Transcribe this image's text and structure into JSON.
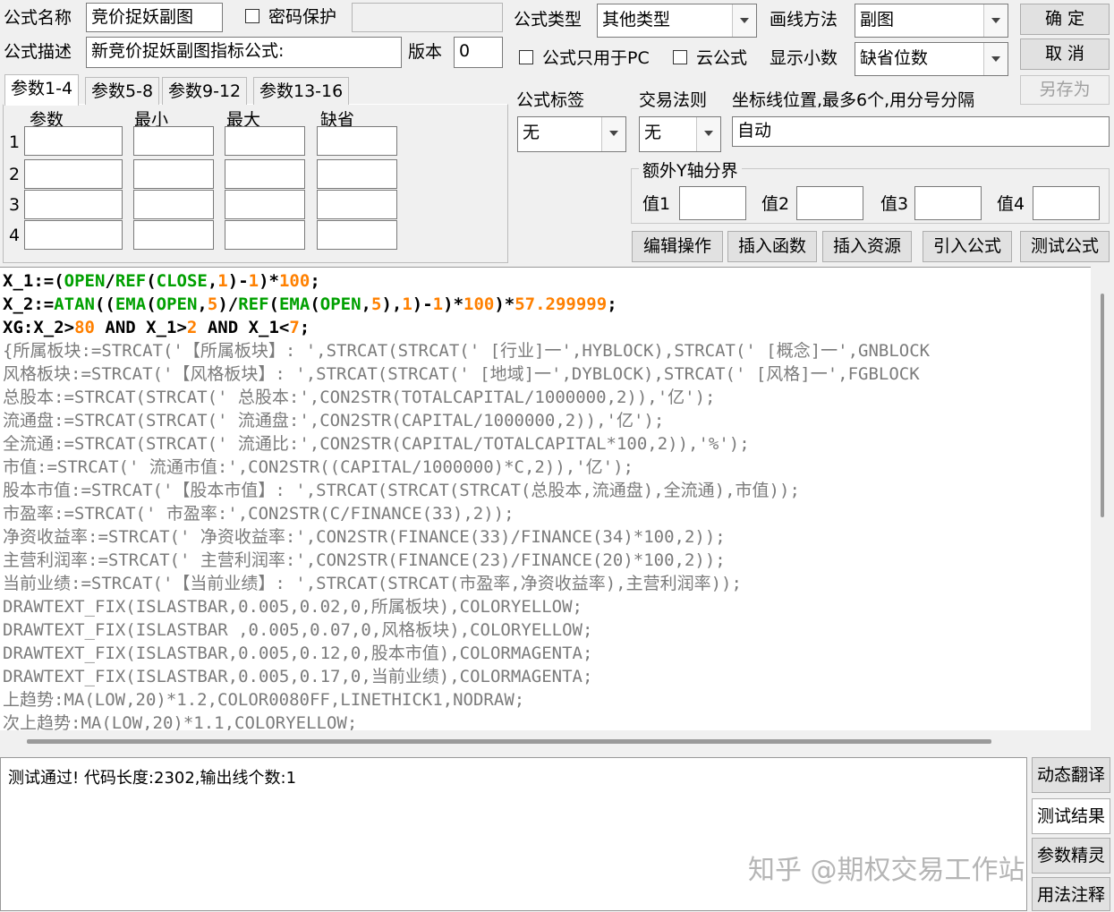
{
  "formula": {
    "name_label": "公式名称",
    "name_value": "竞价捉妖副图",
    "password_label": "密码保护",
    "password_value": "",
    "desc_label": "公式描述",
    "desc_value": "新竞价捉妖副图指标公式:",
    "version_label": "版本",
    "version_value": "0",
    "type_label": "公式类型",
    "type_value": "其他类型",
    "draw_label": "画线方法",
    "draw_value": "副图",
    "pc_only_label": "公式只用于PC",
    "cloud_label": "云公式",
    "decimals_label": "显示小数",
    "decimals_value": "缺省位数",
    "tag_label": "公式标签",
    "tag_value": "无",
    "rule_label": "交易法则",
    "rule_value": "无",
    "axis_label": "坐标线位置,最多6个,用分号分隔",
    "axis_value": "自动"
  },
  "buttons": {
    "ok": "确  定",
    "cancel": "取  消",
    "save_as": "另存为",
    "edit_ops": "编辑操作",
    "insert_func": "插入函数",
    "insert_res": "插入资源",
    "import_formula": "引入公式",
    "test_formula": "测试公式"
  },
  "yaxis": {
    "group_label": "额外Y轴分界",
    "v1_label": "值1",
    "v2_label": "值2",
    "v3_label": "值3",
    "v4_label": "值4"
  },
  "param_tabs": [
    "参数1-4",
    "参数5-8",
    "参数9-12",
    "参数13-16"
  ],
  "param_headers": [
    "参数",
    "最小",
    "最大",
    "缺省"
  ],
  "param_rows": [
    "1",
    "2",
    "3",
    "4"
  ],
  "code_lines": [
    [
      [
        "k",
        "X_1:=("
      ],
      [
        "g",
        "OPEN"
      ],
      [
        "k",
        "/"
      ],
      [
        "g",
        "REF"
      ],
      [
        "k",
        "("
      ],
      [
        "g",
        "CLOSE"
      ],
      [
        "k",
        ","
      ],
      [
        "o",
        "1"
      ],
      [
        "k",
        ")-"
      ],
      [
        "o",
        "1"
      ],
      [
        "k",
        ")*"
      ],
      [
        "o",
        "100"
      ],
      [
        "k",
        ";"
      ]
    ],
    [
      [
        "k",
        "X_2:="
      ],
      [
        "g",
        "ATAN"
      ],
      [
        "k",
        "(("
      ],
      [
        "g",
        "EMA"
      ],
      [
        "k",
        "("
      ],
      [
        "g",
        "OPEN"
      ],
      [
        "k",
        ","
      ],
      [
        "o",
        "5"
      ],
      [
        "k",
        ")/"
      ],
      [
        "g",
        "REF"
      ],
      [
        "k",
        "("
      ],
      [
        "g",
        "EMA"
      ],
      [
        "k",
        "("
      ],
      [
        "g",
        "OPEN"
      ],
      [
        "k",
        ","
      ],
      [
        "o",
        "5"
      ],
      [
        "k",
        "),"
      ],
      [
        "o",
        "1"
      ],
      [
        "k",
        ")-"
      ],
      [
        "o",
        "1"
      ],
      [
        "k",
        ")*"
      ],
      [
        "o",
        "100"
      ],
      [
        "k",
        ")*"
      ],
      [
        "o",
        "57.299999"
      ],
      [
        "k",
        ";"
      ]
    ],
    [
      [
        "k",
        "XG:X_2>"
      ],
      [
        "o",
        "80"
      ],
      [
        "k",
        " AND X_1>"
      ],
      [
        "o",
        "2"
      ],
      [
        "k",
        " AND X_1<"
      ],
      [
        "o",
        "7"
      ],
      [
        "k",
        ";"
      ]
    ],
    [
      [
        "gr",
        "{所属板块:=STRCAT('【所属板块】: ',STRCAT(STRCAT(' [行业]一',HYBLOCK),STRCAT(' [概念]一',GNBLOCK"
      ]
    ],
    [
      [
        "gr",
        "风格板块:=STRCAT('【风格板块】: ',STRCAT(STRCAT(' [地域]一',DYBLOCK),STRCAT(' [风格]一',FGBLOCK"
      ]
    ],
    [
      [
        "gr",
        "总股本:=STRCAT(STRCAT(' 总股本:',CON2STR(TOTALCAPITAL/1000000,2)),'亿');"
      ]
    ],
    [
      [
        "gr",
        "流通盘:=STRCAT(STRCAT(' 流通盘:',CON2STR(CAPITAL/1000000,2)),'亿');"
      ]
    ],
    [
      [
        "gr",
        "全流通:=STRCAT(STRCAT(' 流通比:',CON2STR(CAPITAL/TOTALCAPITAL*100,2)),'%');"
      ]
    ],
    [
      [
        "gr",
        "市值:=STRCAT(' 流通市值:',CON2STR((CAPITAL/1000000)*C,2)),'亿');"
      ]
    ],
    [
      [
        "gr",
        "股本市值:=STRCAT('【股本市值】: ',STRCAT(STRCAT(STRCAT(总股本,流通盘),全流通),市值));"
      ]
    ],
    [
      [
        "gr",
        "市盈率:=STRCAT(' 市盈率:',CON2STR(C/FINANCE(33),2));"
      ]
    ],
    [
      [
        "gr",
        "净资收益率:=STRCAT(' 净资收益率:',CON2STR(FINANCE(33)/FINANCE(34)*100,2));"
      ]
    ],
    [
      [
        "gr",
        "主营利润率:=STRCAT(' 主营利润率:',CON2STR(FINANCE(23)/FINANCE(20)*100,2));"
      ]
    ],
    [
      [
        "gr",
        "当前业绩:=STRCAT('【当前业绩】: ',STRCAT(STRCAT(市盈率,净资收益率),主营利润率));"
      ]
    ],
    [
      [
        "gr",
        "DRAWTEXT_FIX(ISLASTBAR,0.005,0.02,0,所属板块),COLORYELLOW;"
      ]
    ],
    [
      [
        "gr",
        "DRAWTEXT_FIX(ISLASTBAR ,0.005,0.07,0,风格板块),COLORYELLOW;"
      ]
    ],
    [
      [
        "gr",
        "DRAWTEXT_FIX(ISLASTBAR,0.005,0.12,0,股本市值),COLORMAGENTA;"
      ]
    ],
    [
      [
        "gr",
        "DRAWTEXT_FIX(ISLASTBAR,0.005,0.17,0,当前业绩),COLORMAGENTA;"
      ]
    ],
    [
      [
        "gr",
        "上趋势:MA(LOW,20)*1.2,COLOR0080FF,LINETHICK1,NODRAW;"
      ]
    ],
    [
      [
        "gr",
        "次上趋势:MA(LOW,20)*1.1,COLORYELLOW;"
      ]
    ]
  ],
  "output": {
    "text": "测试通过! 代码长度:2302,输出线个数:1"
  },
  "side_buttons": [
    "动态翻译",
    "测试结果",
    "参数精灵",
    "用法注释"
  ],
  "watermark": "知乎 @期权交易工作站"
}
